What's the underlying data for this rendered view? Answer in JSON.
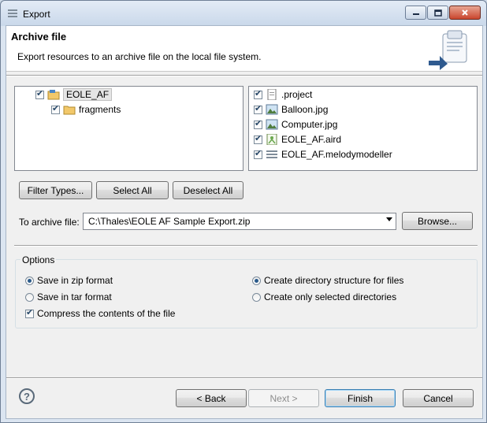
{
  "window": {
    "title": "Export"
  },
  "banner": {
    "title": "Archive file",
    "description": "Export resources to an archive file on the local file system."
  },
  "tree": [
    {
      "label": "EOLE_AF",
      "checked": true,
      "icon": "project-folder-icon",
      "indent": 0,
      "selected": true
    },
    {
      "label": "fragments",
      "checked": true,
      "icon": "folder-icon",
      "indent": 1,
      "selected": false
    }
  ],
  "files": [
    {
      "label": ".project",
      "checked": true,
      "icon": "text-file-icon"
    },
    {
      "label": "Balloon.jpg",
      "checked": true,
      "icon": "image-file-icon"
    },
    {
      "label": "Computer.jpg",
      "checked": true,
      "icon": "image-file-icon"
    },
    {
      "label": "EOLE_AF.aird",
      "checked": true,
      "icon": "aird-file-icon"
    },
    {
      "label": "EOLE_AF.melodymodeller",
      "checked": true,
      "icon": "model-file-icon"
    }
  ],
  "buttons": {
    "filter_types": "Filter Types...",
    "select_all": "Select All",
    "deselect_all": "Deselect All",
    "browse": "Browse...",
    "back": "< Back",
    "next": "Next >",
    "finish": "Finish",
    "cancel": "Cancel"
  },
  "archive": {
    "label": "To archive file:",
    "value": "C:\\Thales\\EOLE AF Sample Export.zip"
  },
  "options": {
    "title": "Options",
    "zip": {
      "label": "Save in zip format",
      "selected": true
    },
    "tar": {
      "label": "Save in tar format",
      "selected": false
    },
    "compress": {
      "label": "Compress the contents of the file",
      "checked": true
    },
    "create_structure": {
      "label": "Create directory structure for files",
      "selected": true
    },
    "selected_only": {
      "label": "Create only selected directories",
      "selected": false
    }
  },
  "help": {
    "symbol": "?"
  }
}
